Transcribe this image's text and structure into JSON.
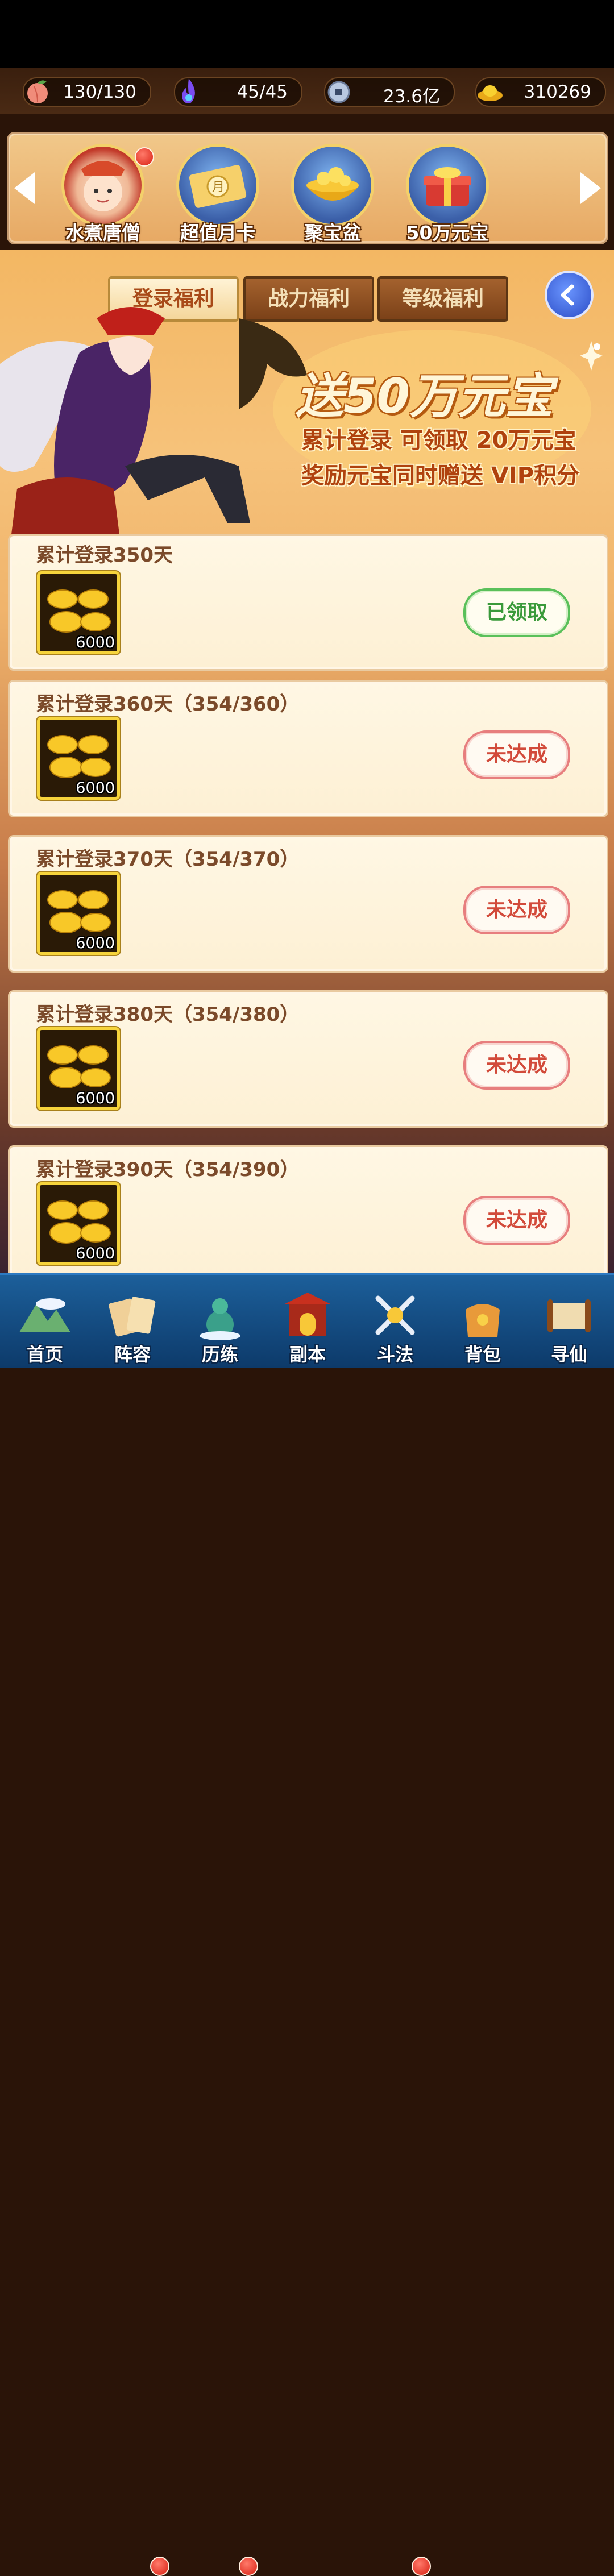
{
  "resources": [
    {
      "icon": "peach-icon",
      "value": "130/130"
    },
    {
      "icon": "spirit-flame-icon",
      "value": "45/45"
    },
    {
      "icon": "copper-coin-icon",
      "value": "23.6亿"
    },
    {
      "icon": "gold-ingot-icon",
      "value": "310269"
    }
  ],
  "events": [
    {
      "label": "水煮唐僧",
      "icon": "monk-avatar-icon",
      "has_badge": true
    },
    {
      "label": "超值月卡",
      "icon": "month-card-icon",
      "has_badge": false
    },
    {
      "label": "聚宝盆",
      "icon": "treasure-bowl-icon",
      "has_badge": false
    },
    {
      "label": "50万元宝",
      "icon": "gift-chest-icon",
      "has_badge": false
    }
  ],
  "tabs": [
    {
      "label": "登录福利",
      "active": true
    },
    {
      "label": "战力福利",
      "active": false
    },
    {
      "label": "等级福利",
      "active": false
    }
  ],
  "banner": {
    "headline": "送50万元宝",
    "line1": "累计登录 可领取 20万元宝",
    "line2": "奖励元宝同时赠送 VIP积分"
  },
  "rewards": [
    {
      "title": "累计登录350天",
      "quantity": "6000",
      "status": "已领取",
      "claimed": true
    },
    {
      "title": "累计登录360天（354/360）",
      "quantity": "6000",
      "status": "未达成",
      "claimed": false
    },
    {
      "title": "累计登录370天（354/370）",
      "quantity": "6000",
      "status": "未达成",
      "claimed": false
    },
    {
      "title": "累计登录380天（354/380）",
      "quantity": "6000",
      "status": "未达成",
      "claimed": false
    },
    {
      "title": "累计登录390天（354/390）",
      "quantity": "6000",
      "status": "未达成",
      "claimed": false
    }
  ],
  "nav": [
    {
      "label": "首页",
      "icon": "home-mountain-icon",
      "has_badge": false
    },
    {
      "label": "阵容",
      "icon": "cards-icon",
      "has_badge": true
    },
    {
      "label": "历练",
      "icon": "gourd-icon",
      "has_badge": true
    },
    {
      "label": "副本",
      "icon": "gate-icon",
      "has_badge": false
    },
    {
      "label": "斗法",
      "icon": "swords-icon",
      "has_badge": true
    },
    {
      "label": "背包",
      "icon": "bag-icon",
      "has_badge": false
    },
    {
      "label": "寻仙",
      "icon": "scroll-icon",
      "has_badge": false
    }
  ],
  "colors": {
    "accent": "#a84a18",
    "claimed": "#3a9a3a",
    "not_done": "#d24a3a",
    "nav": "#1c5f9a"
  }
}
